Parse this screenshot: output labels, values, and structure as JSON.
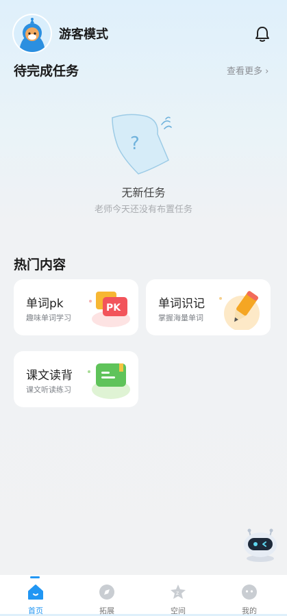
{
  "header": {
    "title": "游客模式"
  },
  "tasks": {
    "title": "待完成任务",
    "more_label": "查看更多 ›",
    "empty_title": "无新任务",
    "empty_subtitle": "老师今天还没有布置任务"
  },
  "hot": {
    "title": "热门内容",
    "cards": [
      {
        "title": "单词pk",
        "subtitle": "趣味单词学习",
        "icon": "pk-icon",
        "badge": "PK"
      },
      {
        "title": "单词识记",
        "subtitle": "掌握海量单词",
        "icon": "pencil-icon"
      },
      {
        "title": "课文读背",
        "subtitle": "课文听读练习",
        "icon": "book-icon"
      }
    ]
  },
  "nav": {
    "items": [
      {
        "label": "首页",
        "icon": "home-icon",
        "active": true
      },
      {
        "label": "拓展",
        "icon": "compass-icon"
      },
      {
        "label": "空间",
        "icon": "star-icon"
      },
      {
        "label": "我的",
        "icon": "face-icon"
      }
    ]
  },
  "colors": {
    "accent": "#2196f3",
    "pk_red": "#f2545b",
    "pencil_orange": "#f5a623",
    "book_green": "#5fc35a"
  }
}
